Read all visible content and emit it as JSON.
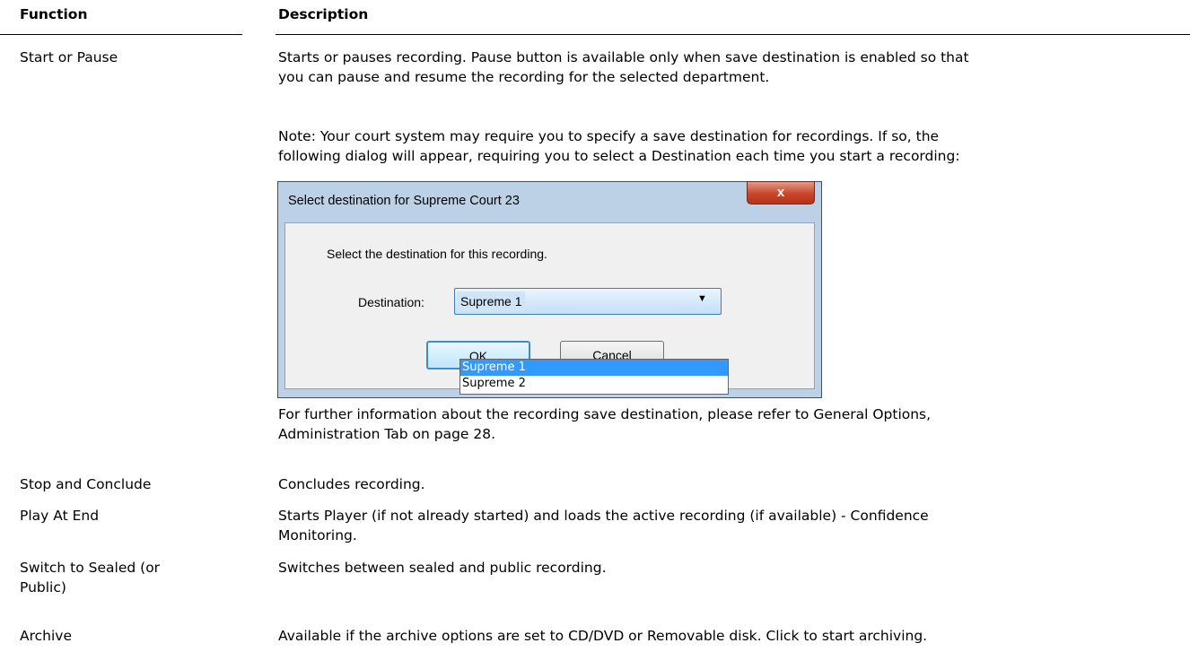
{
  "headers": {
    "function": "Function",
    "description": "Description"
  },
  "rows": [
    {
      "function": "Start or Pause",
      "description_lines": [
        "Starts or pauses recording. Pause button is available only when save destination is enabled so that",
        "you can pause and resume the recording for the selected department."
      ],
      "note_lines": [
        "Note: Your court system may require you to specify a save destination for recordings. If so, the",
        "following dialog will appear, requiring you to select a Destination each time you start a recording:"
      ],
      "after_lines": [
        "For further information about the recording save destination, please refer to General Options,",
        "Administration Tab on page 28."
      ]
    },
    {
      "function": "Stop and Conclude",
      "description_lines": [
        "Concludes recording."
      ]
    },
    {
      "function": "Play At End",
      "description_lines": [
        "Starts Player (if not already started) and loads the active recording (if available) - Confidence",
        "Monitoring."
      ]
    },
    {
      "function_lines": [
        "Switch to Sealed (or",
        "Public)"
      ],
      "description_lines": [
        "Switches between sealed and public recording."
      ]
    },
    {
      "function": "Archive",
      "description_lines": [
        "Available if the archive options are set to CD/DVD or Removable disk.  Click to start archiving."
      ]
    }
  ],
  "dialog": {
    "title": "Select destination for Supreme Court 23",
    "close_glyph": "x",
    "message": "Select the destination for this recording.",
    "destination_label": "Destination:",
    "selected_value": "Supreme 1",
    "options": [
      "Supreme 1",
      "Supreme 2"
    ],
    "highlighted_option": "Supreme 1",
    "ok_label": "OK",
    "cancel_label": "Cancel",
    "colors": {
      "frame": "#bdd1e6",
      "close": "#c8452a",
      "highlight": "#3399ff"
    }
  }
}
